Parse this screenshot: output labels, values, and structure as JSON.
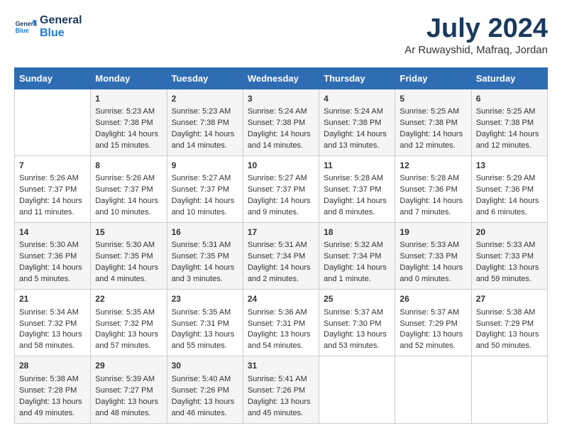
{
  "header": {
    "logo_line1": "General",
    "logo_line2": "Blue",
    "month": "July 2024",
    "location": "Ar Ruwayshid, Mafraq, Jordan"
  },
  "weekdays": [
    "Sunday",
    "Monday",
    "Tuesday",
    "Wednesday",
    "Thursday",
    "Friday",
    "Saturday"
  ],
  "weeks": [
    [
      {
        "day": "",
        "info": ""
      },
      {
        "day": "1",
        "info": "Sunrise: 5:23 AM\nSunset: 7:38 PM\nDaylight: 14 hours\nand 15 minutes."
      },
      {
        "day": "2",
        "info": "Sunrise: 5:23 AM\nSunset: 7:38 PM\nDaylight: 14 hours\nand 14 minutes."
      },
      {
        "day": "3",
        "info": "Sunrise: 5:24 AM\nSunset: 7:38 PM\nDaylight: 14 hours\nand 14 minutes."
      },
      {
        "day": "4",
        "info": "Sunrise: 5:24 AM\nSunset: 7:38 PM\nDaylight: 14 hours\nand 13 minutes."
      },
      {
        "day": "5",
        "info": "Sunrise: 5:25 AM\nSunset: 7:38 PM\nDaylight: 14 hours\nand 12 minutes."
      },
      {
        "day": "6",
        "info": "Sunrise: 5:25 AM\nSunset: 7:38 PM\nDaylight: 14 hours\nand 12 minutes."
      }
    ],
    [
      {
        "day": "7",
        "info": "Sunrise: 5:26 AM\nSunset: 7:37 PM\nDaylight: 14 hours\nand 11 minutes."
      },
      {
        "day": "8",
        "info": "Sunrise: 5:26 AM\nSunset: 7:37 PM\nDaylight: 14 hours\nand 10 minutes."
      },
      {
        "day": "9",
        "info": "Sunrise: 5:27 AM\nSunset: 7:37 PM\nDaylight: 14 hours\nand 10 minutes."
      },
      {
        "day": "10",
        "info": "Sunrise: 5:27 AM\nSunset: 7:37 PM\nDaylight: 14 hours\nand 9 minutes."
      },
      {
        "day": "11",
        "info": "Sunrise: 5:28 AM\nSunset: 7:37 PM\nDaylight: 14 hours\nand 8 minutes."
      },
      {
        "day": "12",
        "info": "Sunrise: 5:28 AM\nSunset: 7:36 PM\nDaylight: 14 hours\nand 7 minutes."
      },
      {
        "day": "13",
        "info": "Sunrise: 5:29 AM\nSunset: 7:36 PM\nDaylight: 14 hours\nand 6 minutes."
      }
    ],
    [
      {
        "day": "14",
        "info": "Sunrise: 5:30 AM\nSunset: 7:36 PM\nDaylight: 14 hours\nand 5 minutes."
      },
      {
        "day": "15",
        "info": "Sunrise: 5:30 AM\nSunset: 7:35 PM\nDaylight: 14 hours\nand 4 minutes."
      },
      {
        "day": "16",
        "info": "Sunrise: 5:31 AM\nSunset: 7:35 PM\nDaylight: 14 hours\nand 3 minutes."
      },
      {
        "day": "17",
        "info": "Sunrise: 5:31 AM\nSunset: 7:34 PM\nDaylight: 14 hours\nand 2 minutes."
      },
      {
        "day": "18",
        "info": "Sunrise: 5:32 AM\nSunset: 7:34 PM\nDaylight: 14 hours\nand 1 minute."
      },
      {
        "day": "19",
        "info": "Sunrise: 5:33 AM\nSunset: 7:33 PM\nDaylight: 14 hours\nand 0 minutes."
      },
      {
        "day": "20",
        "info": "Sunrise: 5:33 AM\nSunset: 7:33 PM\nDaylight: 13 hours\nand 59 minutes."
      }
    ],
    [
      {
        "day": "21",
        "info": "Sunrise: 5:34 AM\nSunset: 7:32 PM\nDaylight: 13 hours\nand 58 minutes."
      },
      {
        "day": "22",
        "info": "Sunrise: 5:35 AM\nSunset: 7:32 PM\nDaylight: 13 hours\nand 57 minutes."
      },
      {
        "day": "23",
        "info": "Sunrise: 5:35 AM\nSunset: 7:31 PM\nDaylight: 13 hours\nand 55 minutes."
      },
      {
        "day": "24",
        "info": "Sunrise: 5:36 AM\nSunset: 7:31 PM\nDaylight: 13 hours\nand 54 minutes."
      },
      {
        "day": "25",
        "info": "Sunrise: 5:37 AM\nSunset: 7:30 PM\nDaylight: 13 hours\nand 53 minutes."
      },
      {
        "day": "26",
        "info": "Sunrise: 5:37 AM\nSunset: 7:29 PM\nDaylight: 13 hours\nand 52 minutes."
      },
      {
        "day": "27",
        "info": "Sunrise: 5:38 AM\nSunset: 7:29 PM\nDaylight: 13 hours\nand 50 minutes."
      }
    ],
    [
      {
        "day": "28",
        "info": "Sunrise: 5:38 AM\nSunset: 7:28 PM\nDaylight: 13 hours\nand 49 minutes."
      },
      {
        "day": "29",
        "info": "Sunrise: 5:39 AM\nSunset: 7:27 PM\nDaylight: 13 hours\nand 48 minutes."
      },
      {
        "day": "30",
        "info": "Sunrise: 5:40 AM\nSunset: 7:26 PM\nDaylight: 13 hours\nand 46 minutes."
      },
      {
        "day": "31",
        "info": "Sunrise: 5:41 AM\nSunset: 7:26 PM\nDaylight: 13 hours\nand 45 minutes."
      },
      {
        "day": "",
        "info": ""
      },
      {
        "day": "",
        "info": ""
      },
      {
        "day": "",
        "info": ""
      }
    ]
  ]
}
